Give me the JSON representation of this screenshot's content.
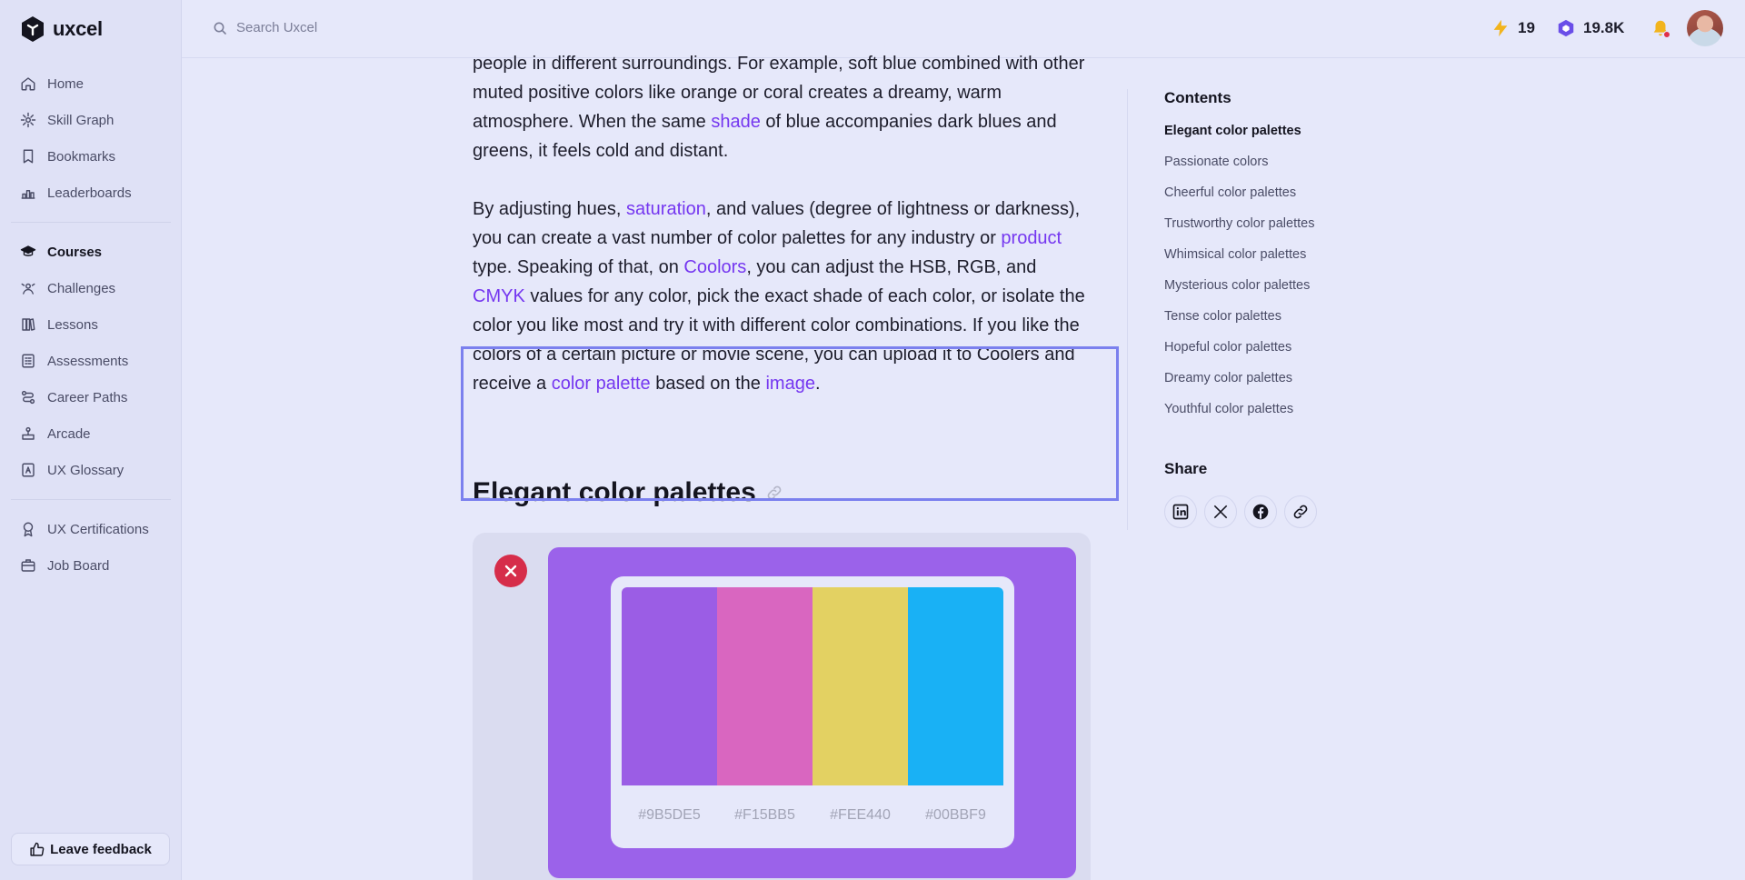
{
  "app": {
    "logo_text": "uxcel"
  },
  "sidebar": {
    "main_items": [
      {
        "label": "Home",
        "icon": "home-icon"
      },
      {
        "label": "Skill Graph",
        "icon": "skill-graph-icon"
      },
      {
        "label": "Bookmarks",
        "icon": "bookmark-icon"
      },
      {
        "label": "Leaderboards",
        "icon": "leaderboard-icon"
      }
    ],
    "learn_items": [
      {
        "label": "Courses",
        "icon": "courses-icon",
        "active": true
      },
      {
        "label": "Challenges",
        "icon": "challenges-icon"
      },
      {
        "label": "Lessons",
        "icon": "lessons-icon"
      },
      {
        "label": "Assessments",
        "icon": "assessments-icon"
      },
      {
        "label": "Career Paths",
        "icon": "career-paths-icon"
      },
      {
        "label": "Arcade",
        "icon": "arcade-icon"
      },
      {
        "label": "UX Glossary",
        "icon": "glossary-icon"
      }
    ],
    "extra_items": [
      {
        "label": "UX Certifications",
        "icon": "certification-icon"
      },
      {
        "label": "Job Board",
        "icon": "job-board-icon"
      }
    ],
    "feedback_label": "Leave feedback"
  },
  "topbar": {
    "search_placeholder": "Search Uxcel",
    "streak": "19",
    "xp": "19.8K",
    "colors": {
      "streak": "#f2b41d",
      "xp": "#6a4ee8",
      "bell": "#f2b41d",
      "bell_dot": "#e0304a"
    }
  },
  "article": {
    "p1": [
      {
        "text": "people in different surroundings. For example, soft blue combined with other muted positive colors like orange or coral creates a dreamy, warm atmosphere. When the same "
      },
      {
        "text": "shade",
        "link": true
      },
      {
        "text": " of blue accompanies dark blues and greens, it feels cold and distant."
      }
    ],
    "p2": [
      {
        "text": "By adjusting hues, "
      },
      {
        "text": "saturation",
        "link": true
      },
      {
        "text": ", and values (degree of lightness or darkness), you can create a vast number of color palettes for any industry or "
      },
      {
        "text": "product",
        "link": true
      },
      {
        "text": " type. Speaking of that, on "
      },
      {
        "text": "Coolors",
        "link": true
      },
      {
        "text": ", you can adjust the HSB, RGB, and "
      },
      {
        "text": "CMYK",
        "link": true
      },
      {
        "text": " values for any color, pick the exact shade of each color, or isolate the color you like most and try it with different color combinations. If you like the colors of a certain picture or movie scene, you can upload it to Coolers and receive a "
      },
      {
        "text": "color palette",
        "link": true
      },
      {
        "text": " based on the "
      },
      {
        "text": "image",
        "link": true
      },
      {
        "text": "."
      }
    ],
    "heading": "Elegant color palettes",
    "link_color": "#7537f0"
  },
  "palette": {
    "status": "incorrect",
    "colors": [
      {
        "hex": "#9B5DE5",
        "value": "#9b5de5"
      },
      {
        "hex": "#F15BB5",
        "value": "#d966c0"
      },
      {
        "hex": "#FEE440",
        "value": "#e3d162"
      },
      {
        "hex": "#00BBF9",
        "value": "#19b1f5"
      }
    ],
    "poster_bg": "#9b62ea"
  },
  "toc": {
    "title": "Contents",
    "items": [
      {
        "label": "Elegant color palettes",
        "active": true
      },
      {
        "label": "Passionate colors"
      },
      {
        "label": "Cheerful color palettes"
      },
      {
        "label": "Trustworthy color palettes"
      },
      {
        "label": "Whimsical color palettes"
      },
      {
        "label": "Mysterious color palettes"
      },
      {
        "label": "Tense color palettes"
      },
      {
        "label": "Hopeful color palettes"
      },
      {
        "label": "Dreamy color palettes"
      },
      {
        "label": "Youthful color palettes"
      }
    ]
  },
  "share": {
    "title": "Share",
    "buttons": [
      "linkedin-icon",
      "x-icon",
      "facebook-icon",
      "copy-link-icon"
    ]
  }
}
